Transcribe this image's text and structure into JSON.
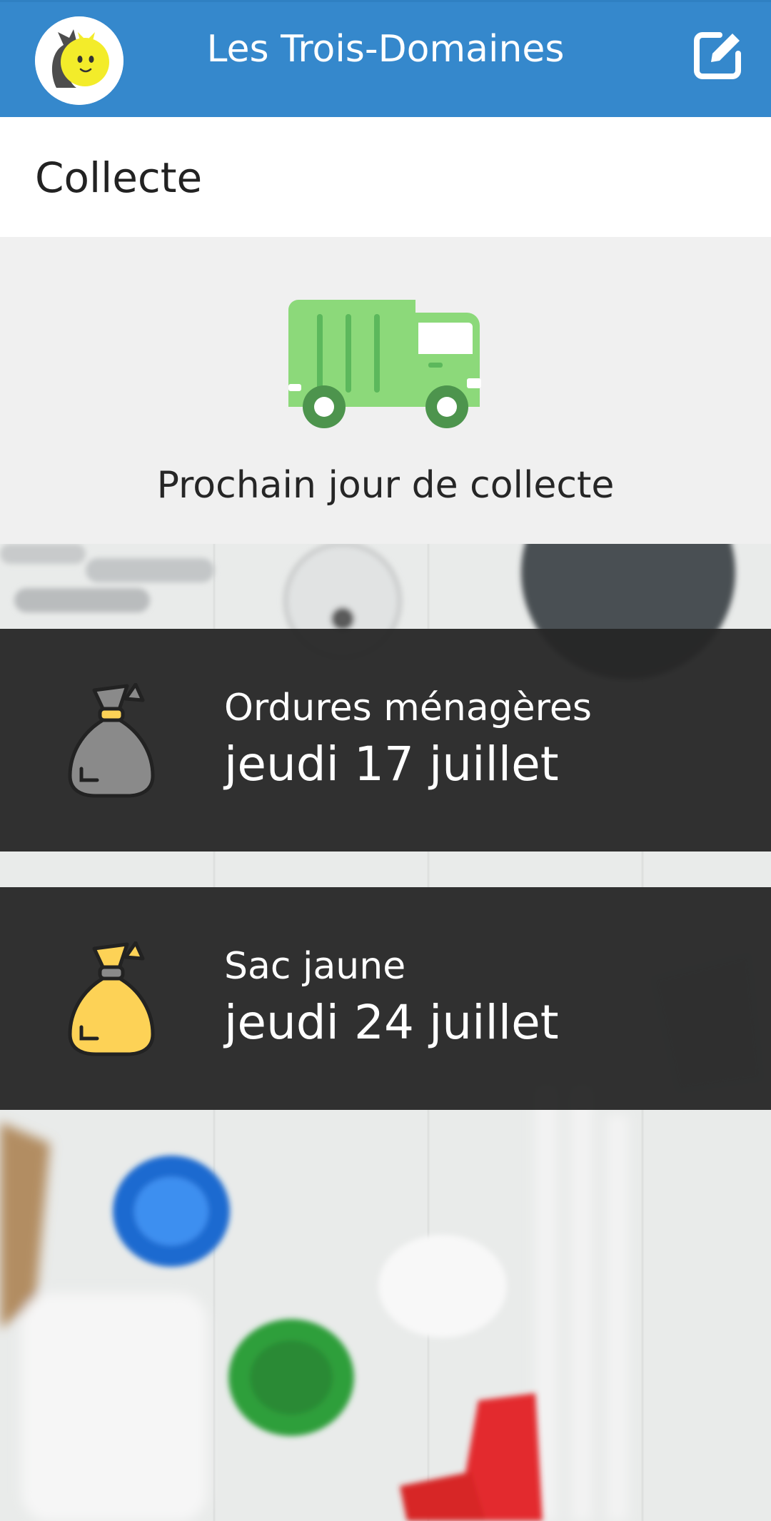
{
  "app_bar": {
    "title": "Les Trois-Domaines",
    "logo_icon": "mascot-logo-icon",
    "edit_icon": "edit-icon",
    "color": "#3588cc"
  },
  "section": {
    "title": "Collecte"
  },
  "hero": {
    "icon": "garbage-truck-icon",
    "label": "Prochain jour de collecte"
  },
  "collections": [
    {
      "type": "Ordures ménagères",
      "date": "jeudi 17 juillet",
      "icon": "grey-trash-bag-icon",
      "bag_color": "#8a8a8a"
    },
    {
      "type": "Sac jaune",
      "date": "jeudi 24 juillet",
      "icon": "yellow-trash-bag-icon",
      "bag_color": "#fdd256"
    }
  ]
}
